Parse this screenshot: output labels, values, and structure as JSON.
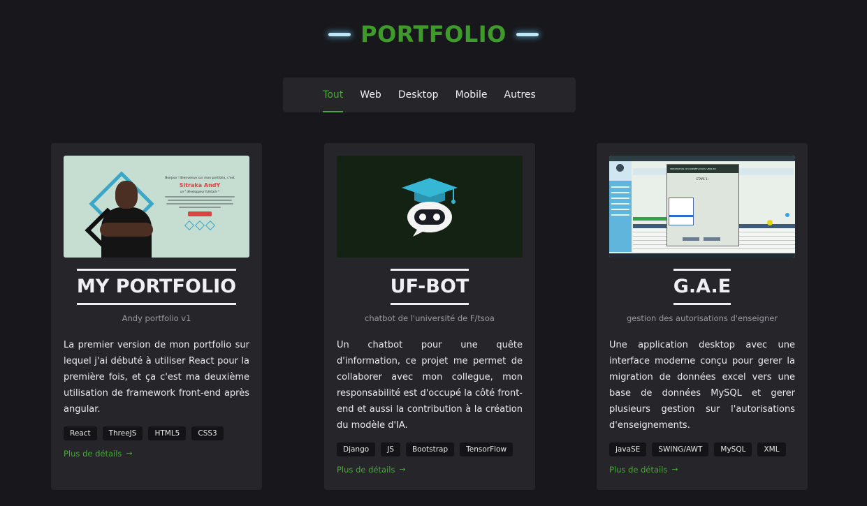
{
  "header": {
    "title": "PORTFOLIO"
  },
  "filters": {
    "active": "Tout",
    "items": [
      {
        "label": "Tout"
      },
      {
        "label": "Web"
      },
      {
        "label": "Desktop"
      },
      {
        "label": "Mobile"
      },
      {
        "label": "Autres"
      }
    ]
  },
  "colors": {
    "accent": "#3f9a2c",
    "link": "#4aa83a",
    "background": "#18181c",
    "card": "#25252a",
    "title_glow": "#bfe7f5"
  },
  "projects": [
    {
      "title": "MY PORTFOLIO",
      "subtitle": "Andy portfolio v1",
      "description": "La premier version de mon portfolio sur lequel j'ai débuté à utiliser React pour la première fois, et ça c'est ma deuxième utilisation de framework front-end après angular.",
      "tags": [
        "React",
        "ThreeJS",
        "HTML5",
        "CSS3"
      ],
      "link": "Plus de détails",
      "thumbnail": {
        "greeting": "Bonjour ! Bienvenue sur mon portfolio, c'est",
        "name": "Sitraka AndY",
        "role": "un * développeur fullstack *"
      }
    },
    {
      "title": "UF-BOT",
      "subtitle": "chatbot de l'université de F/tsoa",
      "description": "Un chatbot pour une quête d'information, ce projet me permet de collaborer avec mon collegue, mon responsabilité est d'occupé la côté front-end et aussi la contribution à la création du modèle d'IA.",
      "tags": [
        "Django",
        "JS",
        "Bootstrap",
        "TensorFlow"
      ],
      "link": "Plus de détails",
      "thumbnail": {}
    },
    {
      "title": "G.A.E",
      "subtitle": "gestion des autorisations d'enseigner",
      "description": "Une application desktop avec une interface moderne conçu pour gerer la migration de données excel vers une base de données MySQL et gerer plusieurs gestion sur l'autorisations d'enseignements.",
      "tags": [
        "javaSE",
        "SWING/AWT",
        "MySQL",
        "XML"
      ],
      "link": "Plus de détails",
      "thumbnail": {
        "dialog_title": "IMPORTATION DE DONNÉES EXCEL VERS BD",
        "step": "ETAPE 1 :"
      }
    }
  ]
}
